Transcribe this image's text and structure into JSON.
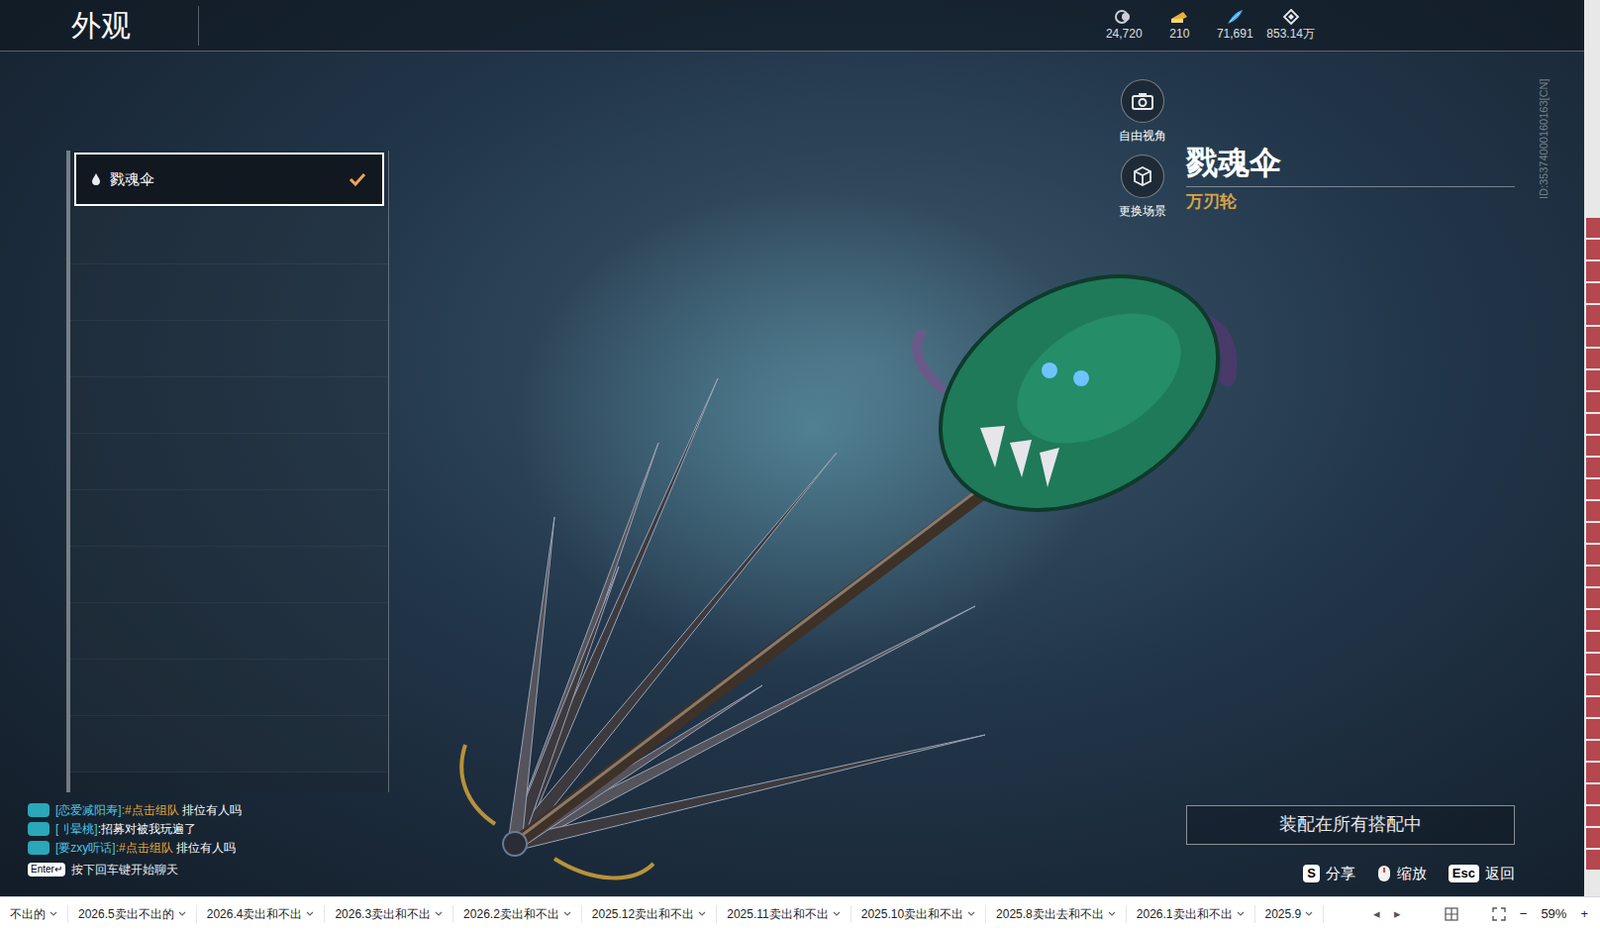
{
  "page": {
    "title": "外观"
  },
  "currencies": [
    {
      "value": "24,720",
      "kind": "coin"
    },
    {
      "value": "210",
      "kind": "ticket"
    },
    {
      "value": "71,691",
      "kind": "feather"
    },
    {
      "value": "853.14万",
      "kind": "gem"
    }
  ],
  "list": {
    "items": [
      {
        "label": "戮魂伞",
        "selected": true,
        "equipped": true
      }
    ],
    "empty_slots": 10
  },
  "view_buttons": [
    {
      "label": "自由视角",
      "kind": "camera"
    },
    {
      "label": "更换场景",
      "kind": "scene"
    }
  ],
  "item": {
    "name": "戮魂伞",
    "weapon": "万刃轮",
    "id": "ID:35374000160163[CN]"
  },
  "equip_button": {
    "label": "装配在所有搭配中"
  },
  "chat": {
    "messages": [
      {
        "name": "[恋爱减阳寿]",
        "link": ":#点击组队",
        "text": " 排位有人吗"
      },
      {
        "name": "[刂晕桃]",
        "link": "",
        "text": ":招募对被我玩遍了"
      },
      {
        "name": "[要zxy听话]",
        "link": ":#点击组队",
        "text": " 排位有人吗"
      }
    ],
    "hint_key": "Enter↵",
    "hint": "按下回车键开始聊天"
  },
  "hints": [
    {
      "key": "S",
      "label": "分享",
      "kind": "key"
    },
    {
      "key": "",
      "label": "缩放",
      "kind": "mouse"
    },
    {
      "key": "Esc",
      "label": "返回",
      "kind": "key"
    }
  ],
  "sheet_bar": {
    "tabs": [
      {
        "label": "不出的",
        "selected": false
      },
      {
        "label": "2026.5卖出不出的",
        "selected": false
      },
      {
        "label": "2026.4卖出和不出",
        "selected": false
      },
      {
        "label": "2026.3卖出和不出",
        "selected": false
      },
      {
        "label": "2026.2卖出和不出",
        "selected": false
      },
      {
        "label": "2025.12卖出和不出",
        "selected": false
      },
      {
        "label": "2025.11卖出和不出",
        "selected": false
      },
      {
        "label": "2025.10卖出和不出",
        "selected": false
      },
      {
        "label": "2025.8卖出去和不出",
        "selected": false
      },
      {
        "label": "2026.1卖出和不出",
        "selected": false
      },
      {
        "label": "2025.9",
        "selected": false
      }
    ],
    "nav": [
      "◂",
      "▸"
    ],
    "zoom": "59%",
    "zoom_out": "−",
    "zoom_in": "+"
  }
}
